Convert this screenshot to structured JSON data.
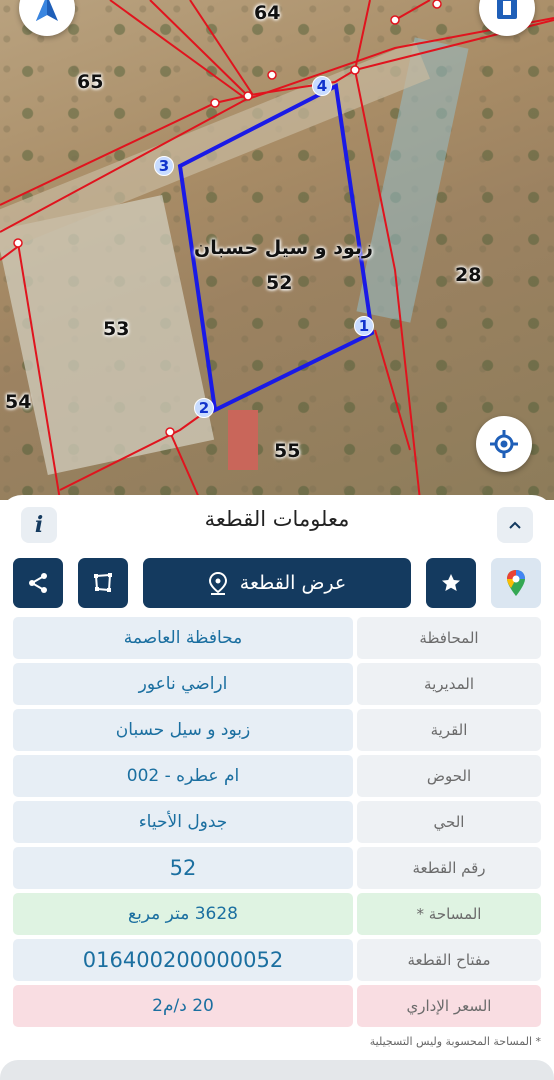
{
  "map": {
    "parcel_numbers": [
      "64",
      "65",
      "28",
      "53",
      "54",
      "55",
      "52"
    ],
    "village_label": "زبود و سيل حسبان",
    "vertices": [
      "1",
      "2",
      "3",
      "4"
    ],
    "icons": {
      "north": "north-arrow-icon",
      "layers": "map-layers-icon",
      "locate": "my-location-icon"
    },
    "colors": {
      "boundary": "#e0141e",
      "selected_parcel": "#1a1ae6"
    }
  },
  "panel": {
    "title": "معلومات القطعة",
    "info_button": "i",
    "show_parcel_label": "عرض القطعة",
    "rows": [
      {
        "label": "المحافظة",
        "value": "محافظة العاصمة"
      },
      {
        "label": "المديرية",
        "value": "اراضي ناعور"
      },
      {
        "label": "القرية",
        "value": "زبود و سيل حسبان"
      },
      {
        "label": "الحوض",
        "value": "ام عطره - 002"
      },
      {
        "label": "الحي",
        "value": "جدول الأحياء"
      },
      {
        "label": "رقم القطعة",
        "value": "52"
      },
      {
        "label": "المساحة *",
        "value": "3628  متر مربع"
      },
      {
        "label": "مفتاح القطعة",
        "value": "016400200000052"
      },
      {
        "label": "السعر الإداري",
        "value": "20 د/م2"
      }
    ],
    "footnote": "* المساحة المحسوبة وليس التسجيلية",
    "colors": {
      "primary": "#143a5f",
      "value_text": "#1b6fa0",
      "area_bg": "#dff3e2",
      "price_bg": "#f9dde2"
    }
  }
}
